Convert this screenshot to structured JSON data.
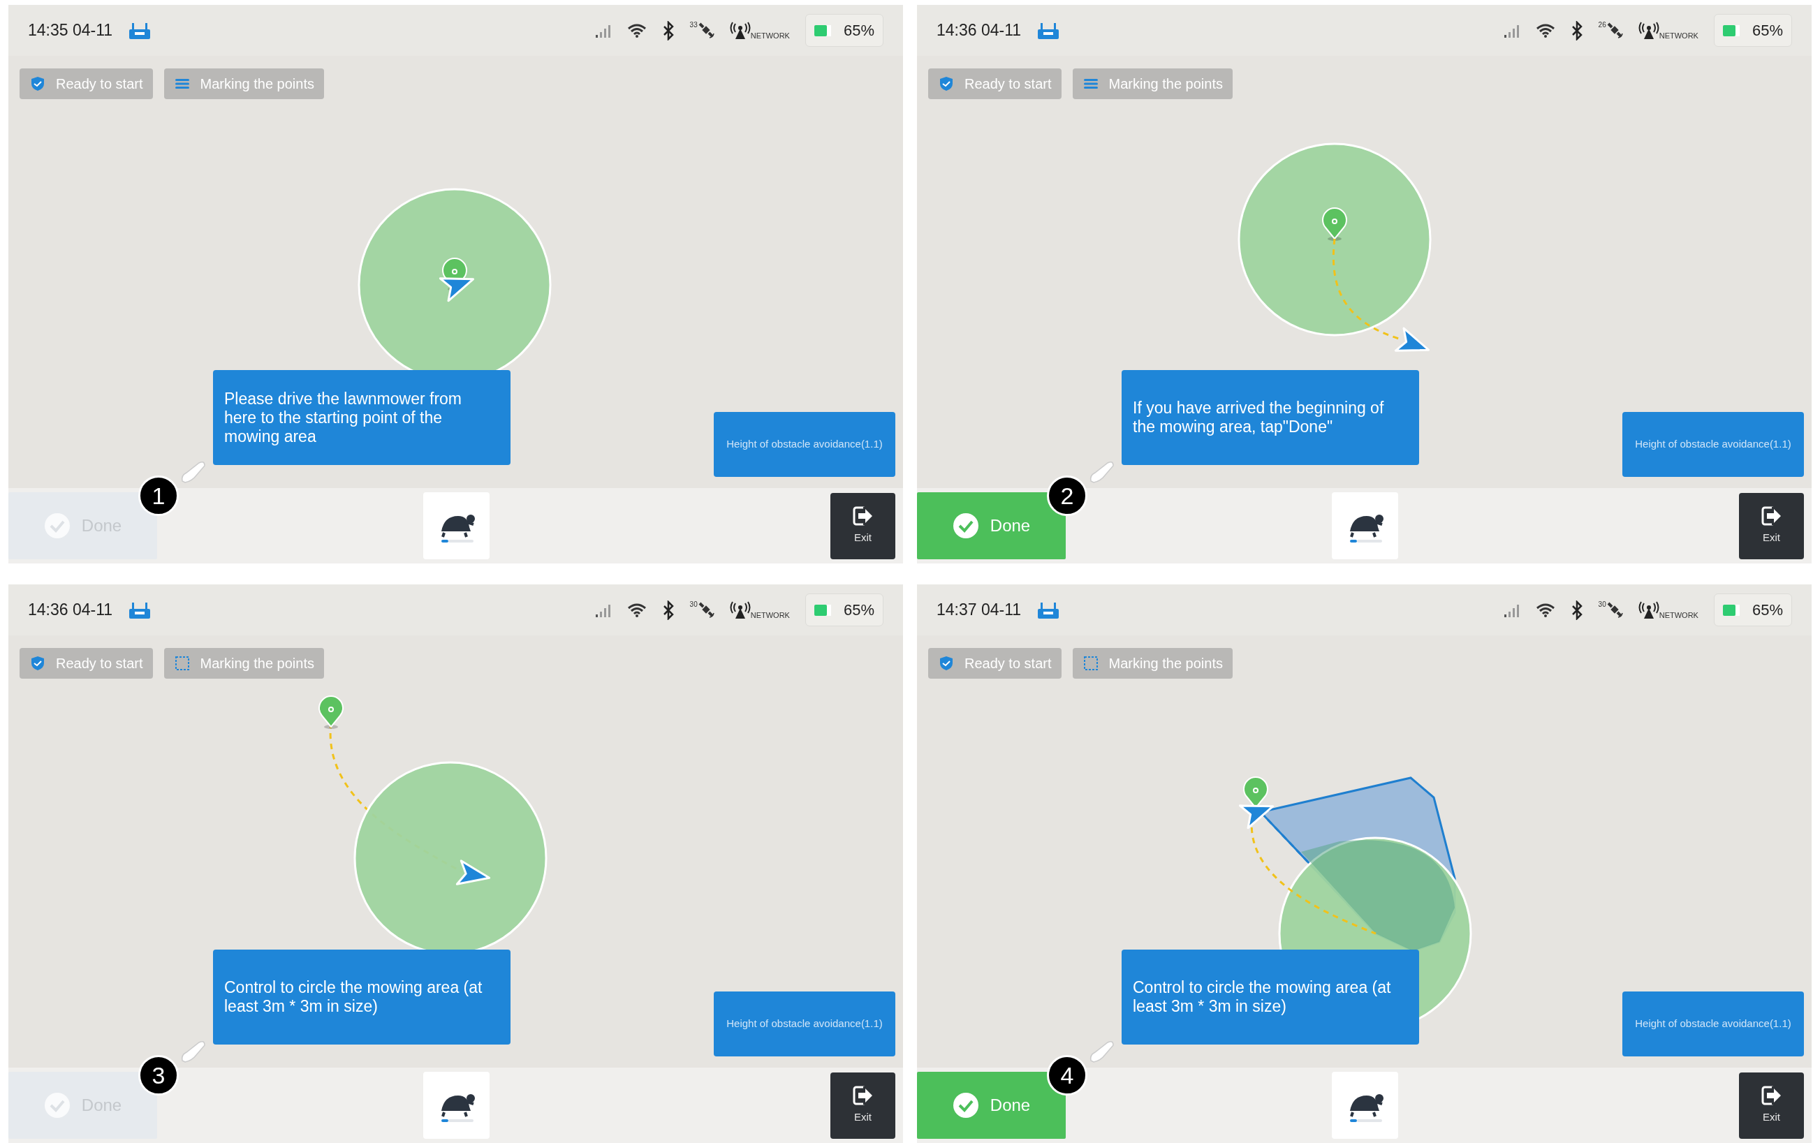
{
  "panels": [
    {
      "step_badge": "1",
      "time": "14:35 04-11",
      "satellites": "33",
      "network_label": "NETWORK",
      "battery": "65%",
      "chips": [
        {
          "label": "Ready to start",
          "kind": "shield"
        },
        {
          "label": "Marking the points",
          "kind": "lines"
        }
      ],
      "map": {
        "kind": "at_start"
      },
      "instruction": "Please drive the lawnmower from here to the starting point of the mowing area",
      "obstacle_button": "Height of obstacle avoidance(1.1)",
      "done": {
        "label": "Done",
        "disabled": true
      },
      "exit": "Exit"
    },
    {
      "step_badge": "2",
      "time": "14:36 04-11",
      "satellites": "26",
      "network_label": "NETWORK",
      "battery": "65%",
      "chips": [
        {
          "label": "Ready to start",
          "kind": "shield"
        },
        {
          "label": "Marking the points",
          "kind": "lines"
        }
      ],
      "map": {
        "kind": "left_start"
      },
      "instruction": "If you have arrived the beginning of the mowing area, tap\"Done\"",
      "obstacle_button": "Height of obstacle avoidance(1.1)",
      "done": {
        "label": "Done",
        "disabled": false
      },
      "exit": "Exit"
    },
    {
      "step_badge": "3",
      "time": "14:36 04-11",
      "satellites": "30",
      "network_label": "NETWORK",
      "battery": "65%",
      "chips": [
        {
          "label": "Ready to start",
          "kind": "shield"
        },
        {
          "label": "Marking the points",
          "kind": "dotted-square"
        }
      ],
      "map": {
        "kind": "returning"
      },
      "instruction": "Control to circle the mowing area (at least 3m * 3m in size)",
      "obstacle_button": "Height of obstacle avoidance(1.1)",
      "done": {
        "label": "Done",
        "disabled": true
      },
      "exit": "Exit"
    },
    {
      "step_badge": "4",
      "time": "14:37 04-11",
      "satellites": "30",
      "network_label": "NETWORK",
      "battery": "65%",
      "chips": [
        {
          "label": "Ready to start",
          "kind": "shield"
        },
        {
          "label": "Marking the points",
          "kind": "dotted-square"
        }
      ],
      "map": {
        "kind": "boundary"
      },
      "instruction": "Control to circle the mowing area (at least 3m * 3m in size)",
      "obstacle_button": "Height of obstacle avoidance(1.1)",
      "done": {
        "label": "Done",
        "disabled": false
      },
      "exit": "Exit"
    }
  ]
}
